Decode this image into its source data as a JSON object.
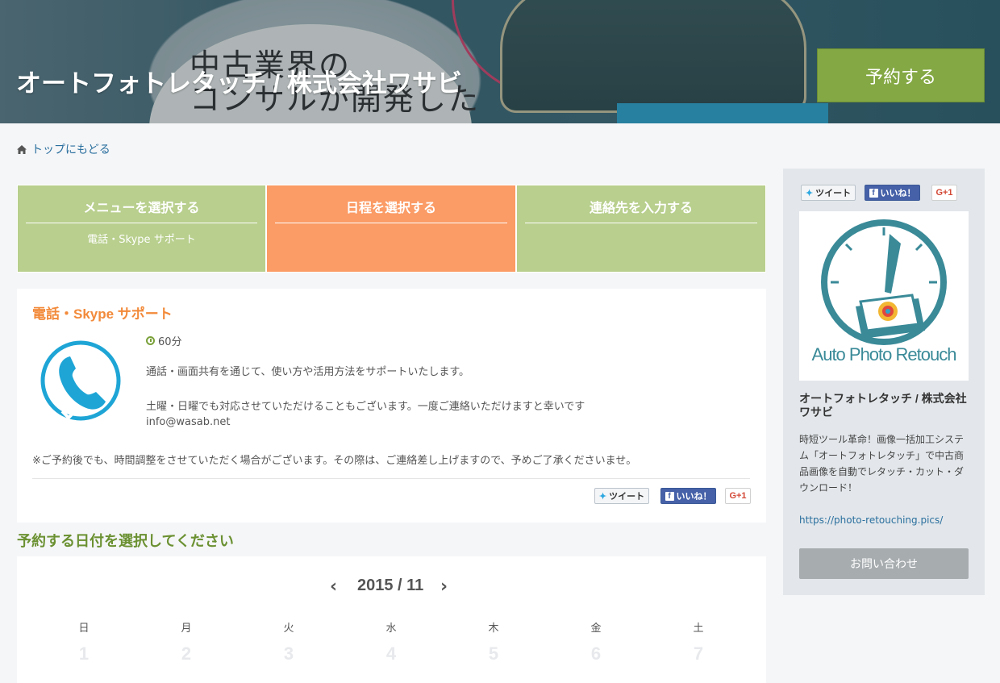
{
  "header": {
    "title": "オートフォトレタッチ / 株式会社ワサビ",
    "banner_text_line1": "中古業界の",
    "banner_text_line2": "コンサルが開発した",
    "reserve_label": "予約する"
  },
  "breadcrumb": {
    "label": "トップにもどる",
    "icon": "home-icon"
  },
  "steps": [
    {
      "label": "メニューを選択する",
      "sub": "電話・Skype サポート",
      "color": "#b8cf8d"
    },
    {
      "label": "日程を選択する",
      "sub": "",
      "color": "#fb9b65"
    },
    {
      "label": "連絡先を入力する",
      "sub": "",
      "color": "#b8cf8d"
    }
  ],
  "menu": {
    "title": "電話・Skype サポート",
    "duration": "60分",
    "desc1": "通話・画面共有を通じて、使い方や活用方法をサポートいたします。",
    "desc2": "土曜・日曜でも対応させていただけることもございます。一度ご連絡いただけますと幸いです",
    "email": "info@wasab.net",
    "note": "※ご予約後でも、時間調整をさせていただく場合がございます。その際は、ご連絡差し上げますので、予めご了承くださいませ。",
    "icon": "phone-icon"
  },
  "share": {
    "tweet": "ツイート",
    "like": "いいね！",
    "gplus": "G+1"
  },
  "calendar": {
    "heading": "予約する日付を選択してください",
    "month": "2015 / 11",
    "prev": "‹",
    "next": "›",
    "weekdays": [
      "日",
      "月",
      "火",
      "水",
      "木",
      "金",
      "土"
    ],
    "days": [
      "1",
      "2",
      "3",
      "4",
      "5",
      "6",
      "7"
    ]
  },
  "sidebar": {
    "logo_text": "Auto Photo Retouch",
    "company": "オートフォトレタッチ / 株式会社ワサビ",
    "desc": "時短ツール革命！画像一括加工システム「オートフォトレタッチ」で中古商品画像を自動でレタッチ・カット・ダウンロード！",
    "url": "https://photo-retouching.pics/",
    "contact": "お問い合わせ"
  },
  "colors": {
    "accent_green": "#84a844",
    "step_active": "#fb9b65",
    "step_inactive": "#b8cf8d",
    "menu_title": "#f28a3a",
    "link": "#2a6f9e"
  }
}
